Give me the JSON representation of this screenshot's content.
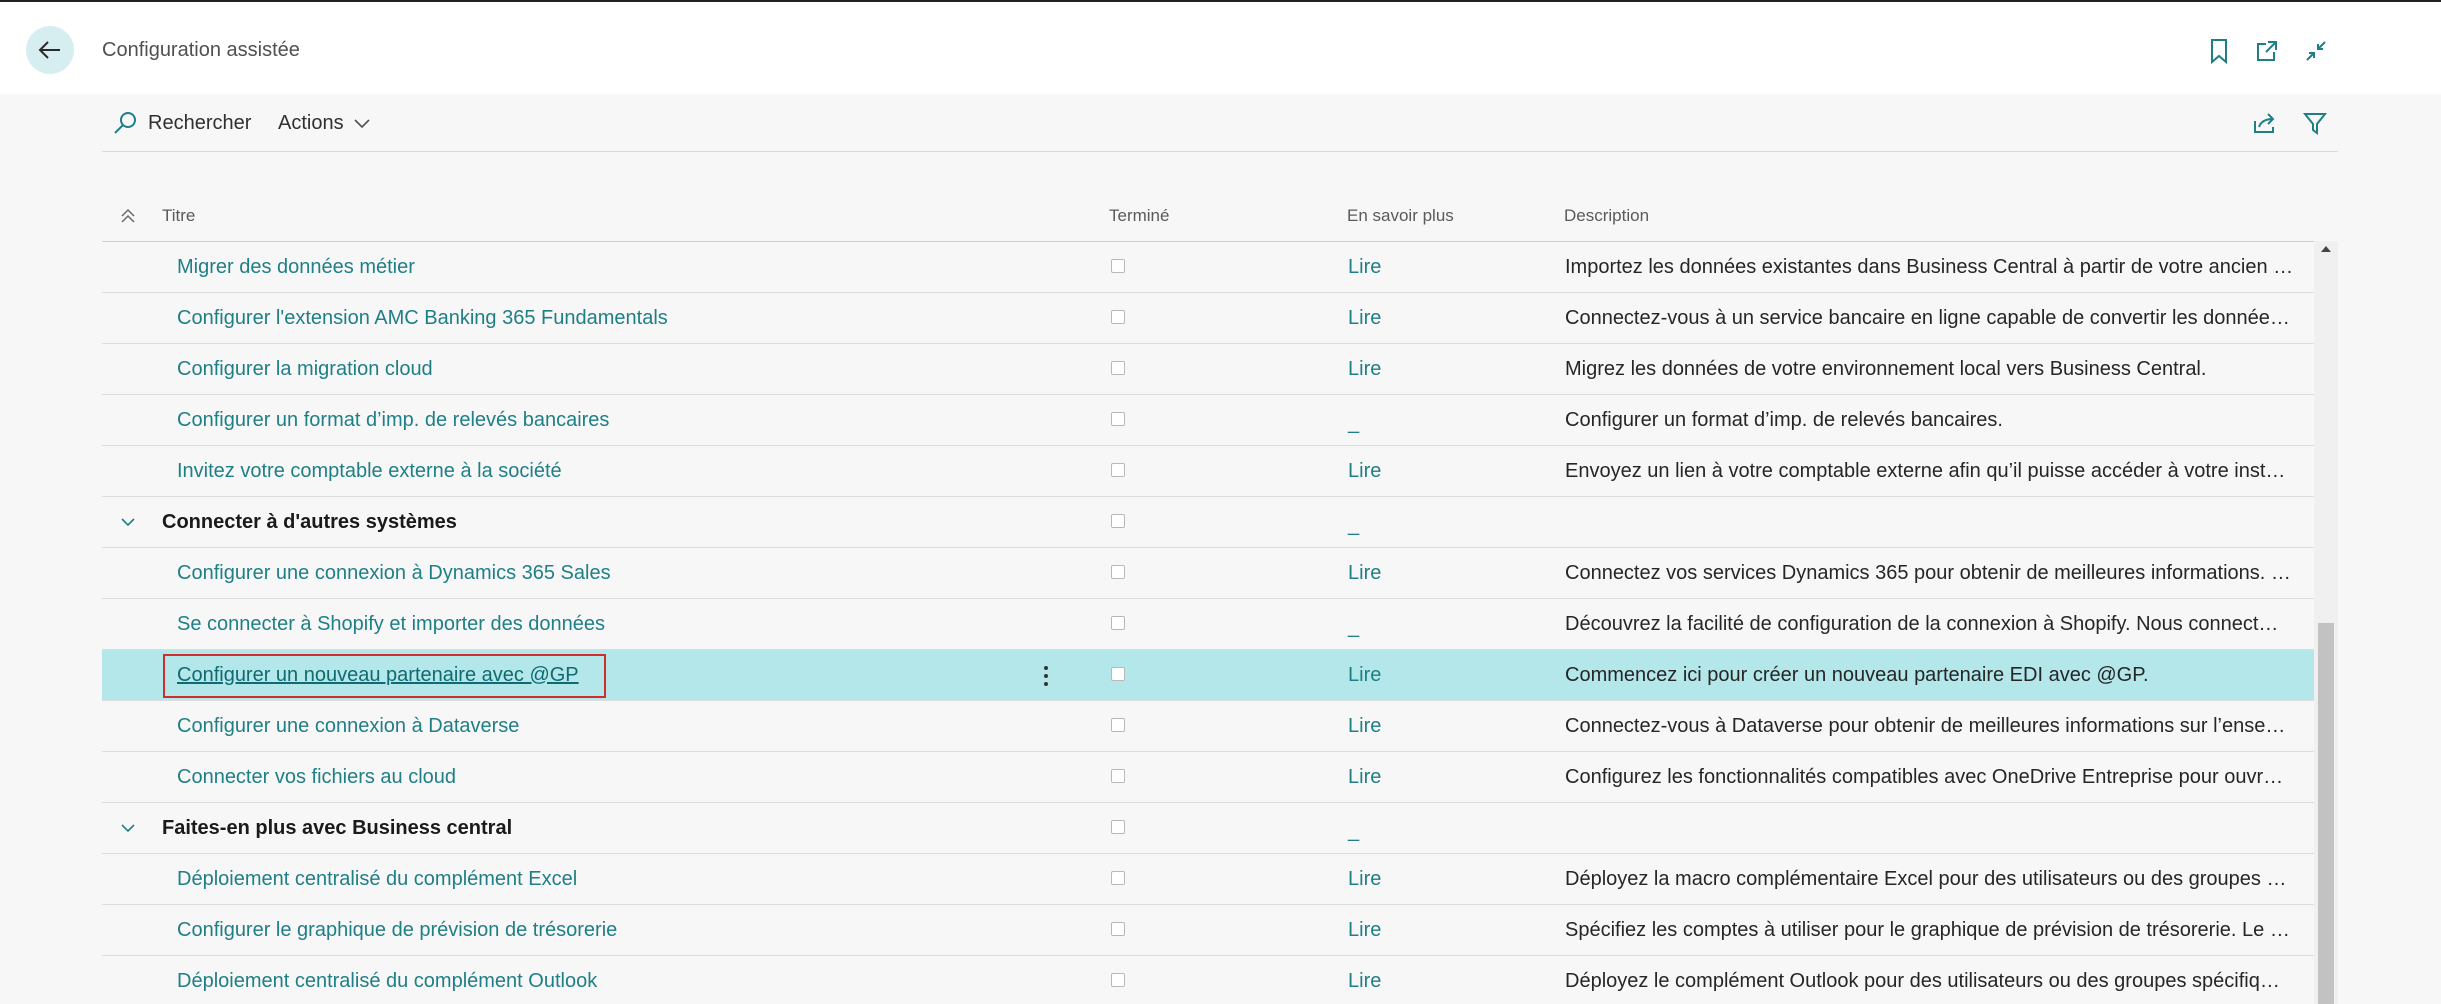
{
  "header": {
    "title": "Configuration assistée",
    "icons": [
      "back-arrow-icon",
      "bookmark-icon",
      "open-new-window-icon",
      "collapse-icon"
    ]
  },
  "toolbar": {
    "search_label": "Rechercher",
    "actions_label": "Actions"
  },
  "columns": {
    "title": "Titre",
    "completed": "Terminé",
    "learn_more": "En savoir plus",
    "description": "Description"
  },
  "rows": [
    {
      "title": "Migrer des données métier",
      "link": "Lire",
      "description": "Importez les données existantes dans Business Central à partir de votre ancien …"
    },
    {
      "title": "Configurer l'extension AMC Banking 365 Fundamentals",
      "link": "Lire",
      "description": "Connectez-vous à un service bancaire en ligne capable de convertir les donnée…"
    },
    {
      "title": "Configurer la migration cloud",
      "link": "Lire",
      "description": "Migrez les données de votre environnement local vers Business Central."
    },
    {
      "title": "Configurer un format d’imp. de relevés bancaires",
      "link": "_",
      "description": "Configurer un format d’imp. de relevés bancaires."
    },
    {
      "title": "Invitez votre comptable externe à la société",
      "link": "Lire",
      "description": "Envoyez un lien à votre comptable externe afin qu’il puisse accéder à votre inst…"
    },
    {
      "title": "Connecter à d'autres systèmes",
      "link": "_",
      "description": ""
    },
    {
      "title": "Configurer une connexion à Dynamics 365 Sales",
      "link": "Lire",
      "description": "Connectez vos services Dynamics 365 pour obtenir de meilleures informations. …"
    },
    {
      "title": "Se connecter à Shopify et importer des données",
      "link": "_",
      "description": "Découvrez la facilité de configuration de la connexion à Shopify. Nous connect…"
    },
    {
      "title": "Configurer un nouveau partenaire avec @GP",
      "link": "Lire",
      "description": "Commencez ici pour créer un nouveau partenaire EDI avec @GP."
    },
    {
      "title": "Configurer une connexion à Dataverse",
      "link": "Lire",
      "description": "Connectez-vous à Dataverse pour obtenir de meilleures informations sur l’ense…"
    },
    {
      "title": "Connecter vos fichiers au cloud",
      "link": "Lire",
      "description": "Configurez les fonctionnalités compatibles avec OneDrive Entreprise pour ouvr…"
    },
    {
      "title": "Faites-en plus avec Business central",
      "link": "_",
      "description": ""
    },
    {
      "title": "Déploiement centralisé du complément Excel",
      "link": "Lire",
      "description": "Déployez la macro complémentaire Excel pour des utilisateurs ou des groupes …"
    },
    {
      "title": "Configurer le graphique de prévision de trésorerie",
      "link": "Lire",
      "description": "Spécifiez les comptes à utiliser pour le graphique de prévision de trésorerie. Le …"
    },
    {
      "title": "Déploiement centralisé du complément Outlook",
      "link": "Lire",
      "description": "Déployez le complément Outlook pour des utilisateurs ou des groupes spécifiq…"
    }
  ],
  "colors": {
    "accent": "#1f7f86",
    "selected_row": "#b3e7ea",
    "highlight_box": "#d22d2d"
  }
}
